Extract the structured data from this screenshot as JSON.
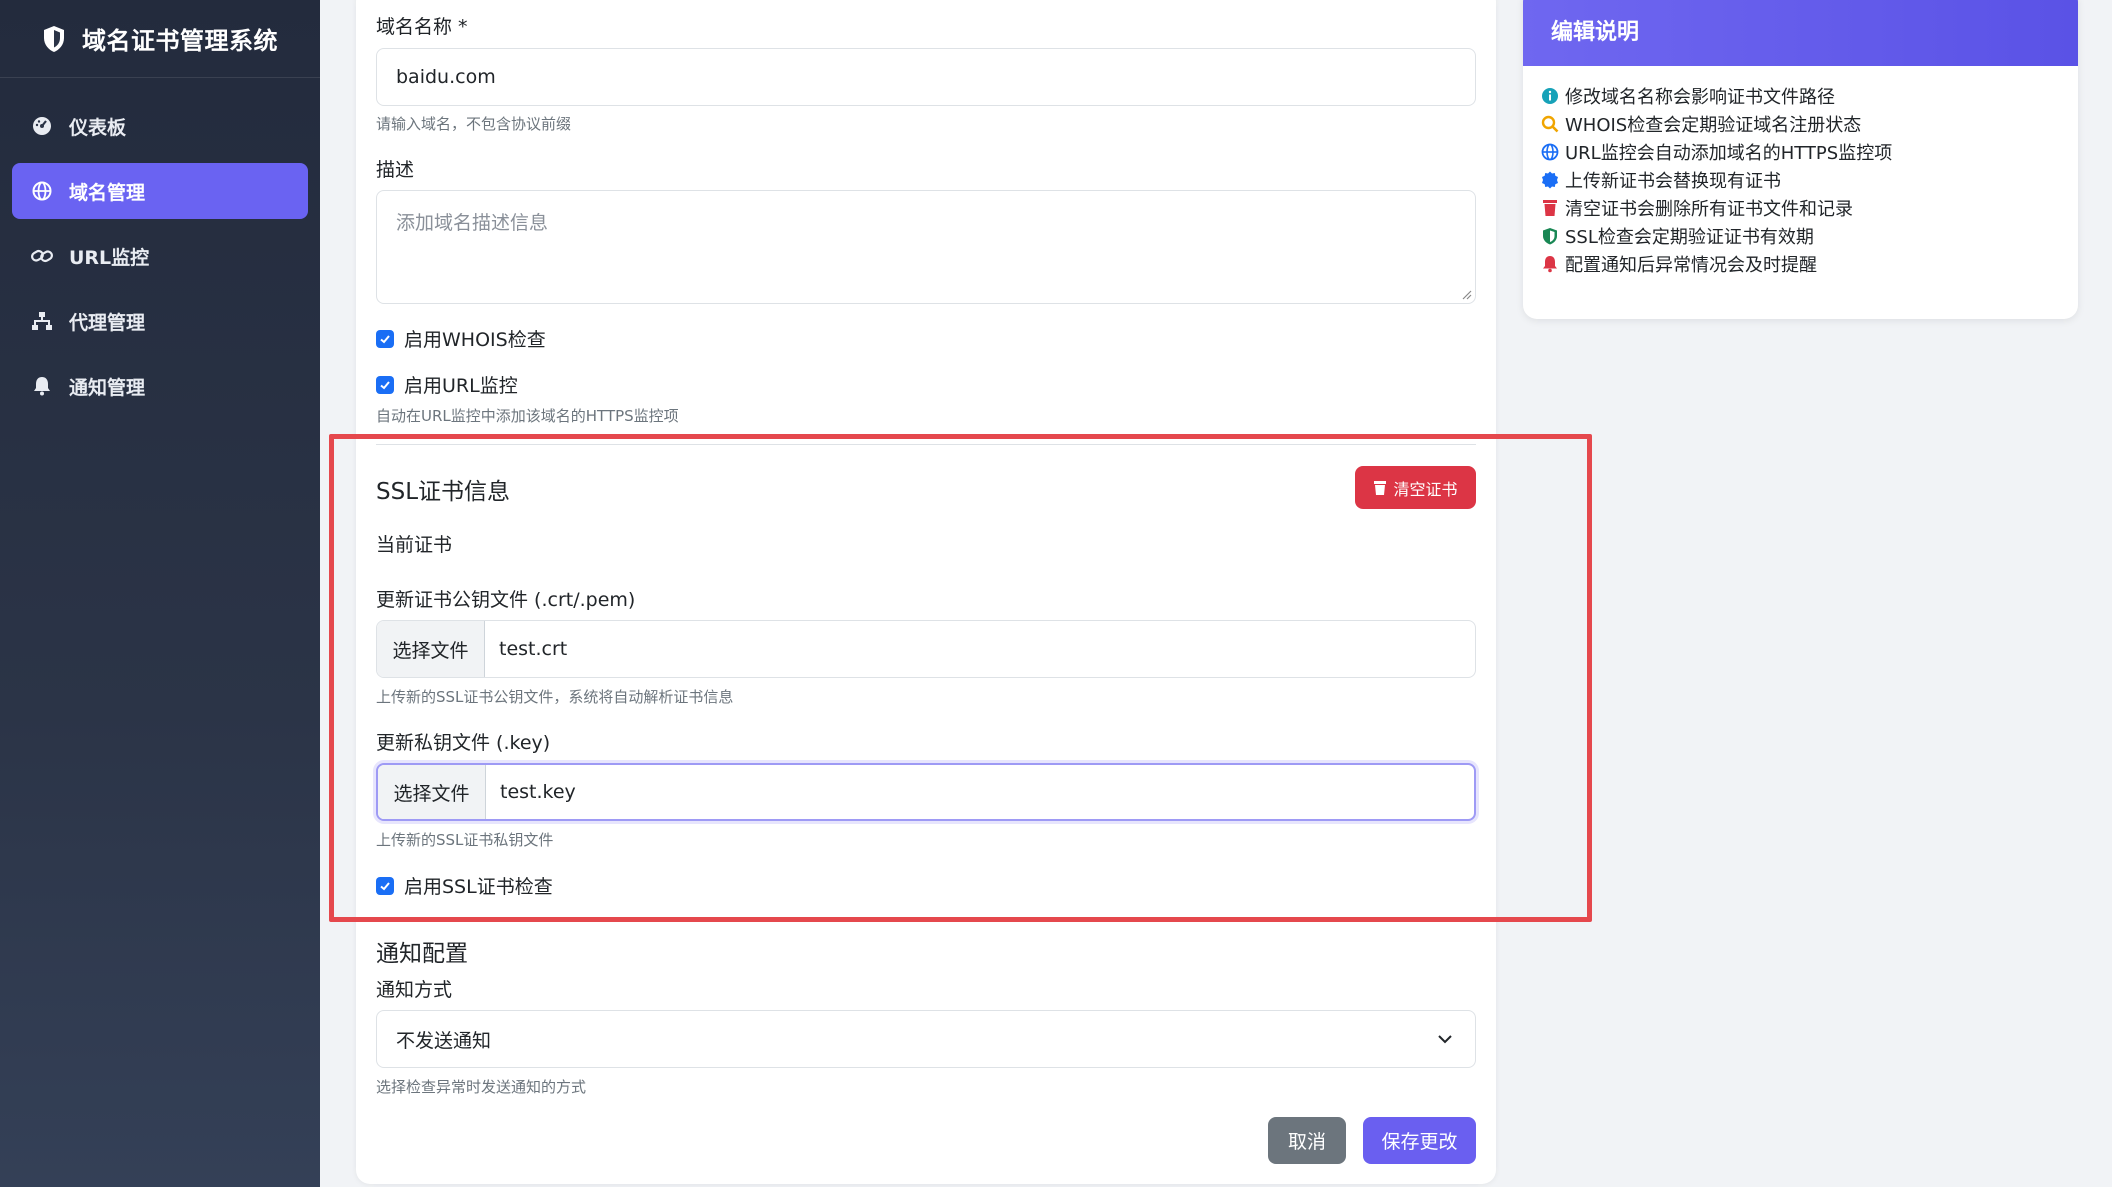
{
  "app": {
    "title": "域名证书管理系统"
  },
  "sidebar": {
    "items": [
      {
        "label": "仪表板",
        "icon": "dashboard-icon"
      },
      {
        "label": "域名管理",
        "icon": "globe-icon",
        "active": true
      },
      {
        "label": "URL监控",
        "icon": "link-icon"
      },
      {
        "label": "代理管理",
        "icon": "sitemap-icon"
      },
      {
        "label": "通知管理",
        "icon": "bell-icon"
      }
    ]
  },
  "form": {
    "domain_label": "域名名称 *",
    "domain_value": "baidu.com",
    "domain_help": "请输入域名，不包含协议前缀",
    "desc_label": "描述",
    "desc_placeholder": "添加域名描述信息",
    "whois_label": "启用WHOIS检查",
    "url_label": "启用URL监控",
    "url_help": "自动在URL监控中添加该域名的HTTPS监控项"
  },
  "ssl": {
    "title": "SSL证书信息",
    "clear_button": "清空证书",
    "current_label": "当前证书",
    "cert_label": "更新证书公钥文件 (.crt/.pem)",
    "cert_button": "选择文件",
    "cert_file": "test.crt",
    "cert_help": "上传新的SSL证书公钥文件，系统将自动解析证书信息",
    "key_label": "更新私钥文件 (.key)",
    "key_button": "选择文件",
    "key_file": "test.key",
    "key_help": "上传新的SSL证书私钥文件",
    "check_label": "启用SSL证书检查"
  },
  "notify": {
    "title": "通知配置",
    "method_label": "通知方式",
    "method_value": "不发送通知",
    "help": "选择检查异常时发送通知的方式"
  },
  "actions": {
    "cancel": "取消",
    "save": "保存更改"
  },
  "info": {
    "title": "编辑说明",
    "items": [
      {
        "text": "修改域名名称会影响证书文件路径",
        "icon": "info-circle-icon",
        "color": "#17a2b8"
      },
      {
        "text": "WHOIS检查会定期验证域名注册状态",
        "icon": "search-icon",
        "color": "#f0a500"
      },
      {
        "text": "URL监控会自动添加域名的HTTPS监控项",
        "icon": "globe-icon",
        "color": "#1a6ef5"
      },
      {
        "text": "上传新证书会替换现有证书",
        "icon": "certificate-icon",
        "color": "#1a6ef5"
      },
      {
        "text": "清空证书会删除所有证书文件和记录",
        "icon": "trash-icon",
        "color": "#dc3545"
      },
      {
        "text": "SSL检查会定期验证证书有效期",
        "icon": "shield-icon",
        "color": "#198754"
      },
      {
        "text": "配置通知后异常情况会及时提醒",
        "icon": "bell-icon",
        "color": "#dc3545"
      }
    ]
  },
  "colors": {
    "accent": "#6a63f2",
    "danger": "#dc3545",
    "checkbox": "#1a6ef5",
    "highlight": "#e5484d"
  }
}
